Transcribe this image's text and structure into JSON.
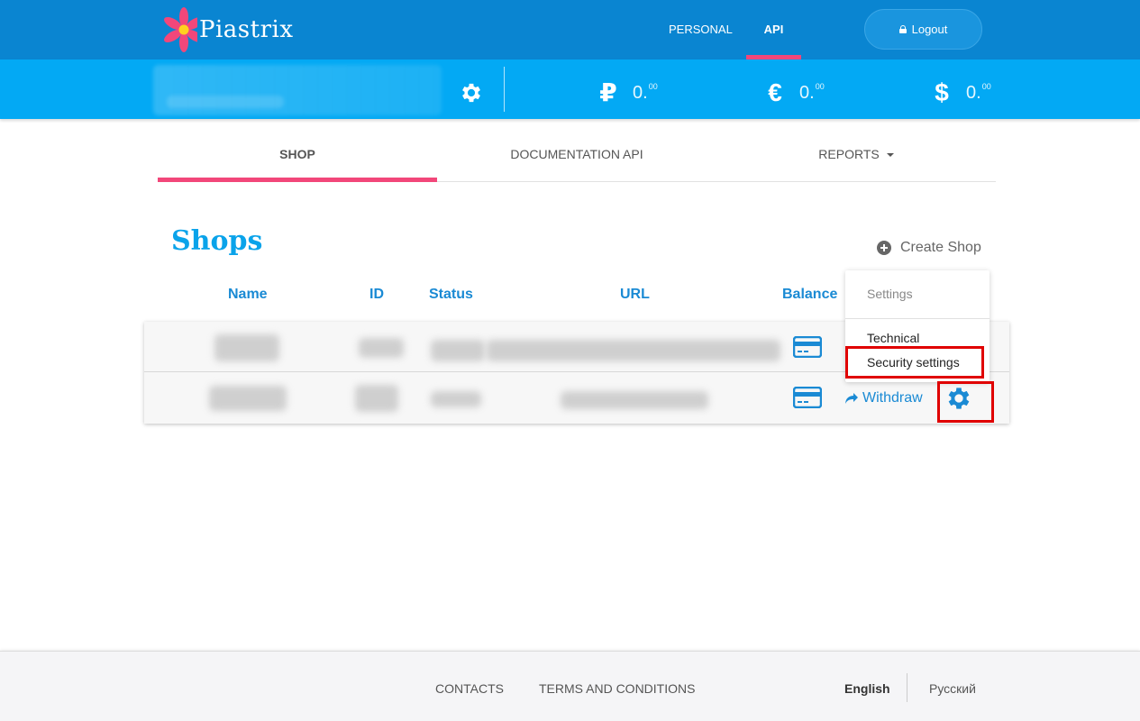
{
  "brand": {
    "name": "Piastrix"
  },
  "topnav": {
    "items": [
      {
        "label": "PERSONAL",
        "active": false
      },
      {
        "label": "API",
        "active": true
      }
    ],
    "logout_label": "Logout"
  },
  "balances": [
    {
      "currency": "RUB",
      "symbol": "₽",
      "integer": "0.",
      "decimals": "00"
    },
    {
      "currency": "EUR",
      "symbol": "€",
      "integer": "0.",
      "decimals": "00"
    },
    {
      "currency": "USD",
      "symbol": "$",
      "integer": "0.",
      "decimals": "00"
    }
  ],
  "tabs": [
    {
      "label": "SHOP",
      "active": true
    },
    {
      "label": "DOCUMENTATION API",
      "active": false
    },
    {
      "label": "REPORTS",
      "active": false,
      "dropdown": true
    }
  ],
  "shops": {
    "title": "Shops",
    "create_label": "Create Shop",
    "columns": [
      "Name",
      "ID",
      "Status",
      "URL",
      "Balance"
    ],
    "rows": [
      {
        "withdraw_label": ""
      },
      {
        "withdraw_label": "Withdraw"
      }
    ]
  },
  "settings_menu": {
    "header": "Settings",
    "items": [
      "Technical",
      "Security settings"
    ]
  },
  "footer": {
    "links": [
      "CONTACTS",
      "TERMS AND CONDITIONS"
    ],
    "languages": [
      {
        "label": "English",
        "active": true
      },
      {
        "label": "Русский",
        "active": false
      }
    ]
  },
  "colors": {
    "topbar": "#0a85d1",
    "balancebar": "#03a9f4",
    "accent_pink": "#f2477a",
    "link_blue": "#1a8ad4",
    "highlight_red": "#e00000"
  },
  "icons": {
    "logo": "flower-logo-icon",
    "logout": "lock-icon",
    "account_settings": "gear-icon",
    "create": "plus-circle-icon",
    "balance": "credit-card-icon",
    "withdraw": "share-arrow-icon",
    "shop_settings": "gear-icon"
  }
}
